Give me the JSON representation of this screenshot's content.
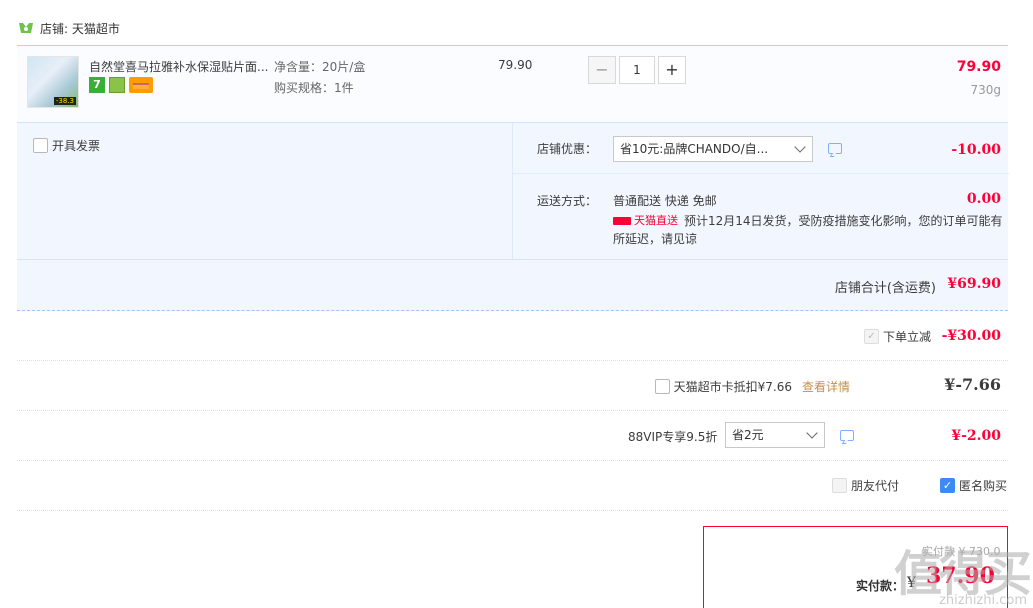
{
  "shop": {
    "prefix": "店铺: ",
    "name": "天猫超市"
  },
  "item": {
    "title": "自然堂喜马拉雅补水保湿贴片面...",
    "thumb_badge": "-38.3",
    "icon_7": "7",
    "spec_net": "净含量：20片/盒",
    "spec_buy": "购买规格：1件",
    "unit_price": "79.90",
    "qty_minus": "−",
    "quantity": "1",
    "qty_plus": "+",
    "subtotal": "79.90",
    "weight": "730g",
    "icons": [
      "seven-day-return-icon",
      "green-badge-icon",
      "credit-card-icon"
    ]
  },
  "options": {
    "invoice_label": "开具发票",
    "shop_discount_label": "店铺优惠：",
    "shop_discount_value": "省10元:品牌CHANDO/自...",
    "shop_discount_amount": "-10.00",
    "shipping_label": "运送方式：",
    "shipping_value": "普通配送 快递 免邮",
    "shipping_amount": "0.00",
    "tmall_direct": "天猫直送",
    "notice": "预计12月14日发货，受防疫措施变化影响，您的订单可能有所延迟，请见谅"
  },
  "shop_total": {
    "label": "店铺合计(含运费)",
    "amount": "¥69.90"
  },
  "order_discount": {
    "label": "下单立减",
    "amount": "-¥30.00",
    "check_mark": "✓"
  },
  "card_deduct": {
    "label": "天猫超市卡抵扣¥7.66",
    "link": "查看详情",
    "amount": "¥-7.66"
  },
  "vip": {
    "label": "88VIP专享9.5折",
    "select_value": "省2元",
    "amount": "¥-2.00"
  },
  "pay_options": {
    "friend_pay": "朋友代付",
    "anonymous": "匿名购买",
    "check_mark": "✓"
  },
  "pay": {
    "faded_text": "实付款 ¥ 730.0",
    "label": "实付款：",
    "currency": "¥",
    "amount": "37.90"
  },
  "watermark": {
    "main": "值得买",
    "sub": "zhizhizhi.com"
  },
  "colors": {
    "price_red": "#ff0036",
    "accent_blue": "#3d8af7",
    "panel_bg": "#f2f7ff",
    "link_gold": "#c58d4f"
  }
}
